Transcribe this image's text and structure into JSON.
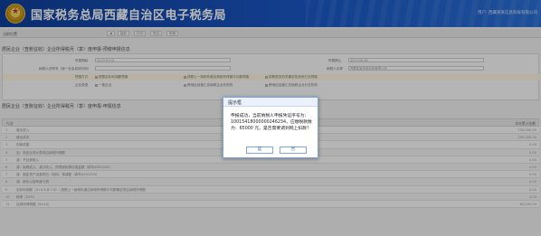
{
  "header": {
    "title": "国家税务总局西藏自治区电子税务局",
    "user_info": "用户: 西藏某某信息科技有限公司"
  },
  "toolbar": {
    "crumb": "当前位置",
    "buttons": [
      "◀",
      "保存",
      "打印",
      "导出",
      "申报"
    ]
  },
  "form_section": {
    "title": "居民企业（查账征收）企业所得税月（季）度申报-预缴申报信息",
    "rows": [
      {
        "label": "所属期起",
        "value": "2019-07-01",
        "label2": "所属期止",
        "value2": "2019-09-30"
      },
      {
        "label": "纳税人识别号（统一社会信用代码）",
        "value": "",
        "label2": "纳税人名称",
        "value2": "西藏某某信息科技有限公司"
      },
      {
        "label": "预缴方式",
        "value": "按照实际利润额预缴",
        "options": [
          "按照上一纳税年度应纳税所得额平均额预缴",
          "按照税务机关确定的其他方法预缴"
        ]
      },
      {
        "label": "企业类型",
        "value": "一般企业",
        "options": [
          "跨地区经营汇总纳税企业总机构",
          "跨地区经营汇总纳税企业分支机构"
        ]
      }
    ]
  },
  "table_section": {
    "title": "居民企业（查账征收）企业所得税月（季）度申报-申报信息",
    "col_index": "行次",
    "col_amount": "本年累计金额",
    "rows": [
      {
        "idx": "1",
        "label": "营业收入",
        "value": "200,000.00"
      },
      {
        "idx": "2",
        "label": "营业成本",
        "value": "200,000.00"
      },
      {
        "idx": "3",
        "label": "利润总额",
        "value": "0.00"
      },
      {
        "idx": "4",
        "label": "加：特定业务计算的应纳税所得额",
        "value": "0.00"
      },
      {
        "idx": "5",
        "label": "减：不征税收入",
        "value": "0.00"
      },
      {
        "idx": "6",
        "label": "减：免税收入、减计收入、所得减免等优惠金额（填写A201010）",
        "value": "0.00"
      },
      {
        "idx": "7",
        "label": "减：固定资产加速折旧（扣除）调减额（填写A201020）",
        "value": "0.00"
      },
      {
        "idx": "8",
        "label": "减：弥补以前年度亏损",
        "value": "0.00"
      },
      {
        "idx": "9",
        "label": "实际利润额（3+4-5-6-7-8）\\ 按照上一纳税年度应纳税所得额平均额确定的应纳税所得额",
        "value": "0.00"
      },
      {
        "idx": "10",
        "label": "税率（25%）",
        "value": "0.00"
      },
      {
        "idx": "11",
        "label": "应纳所得税额（9×10）",
        "value": "65,000.00"
      }
    ]
  },
  "dialog": {
    "title": "提示框",
    "message": "申报成功，当前纳税人申报凭证序号为：10015418000000246234，应缴税款数为：65000 元。是否需要调到网上扣款？",
    "confirm_label": "是",
    "cancel_label": "否"
  },
  "colors": {
    "header_bg": "#1b57c4",
    "dialog_border": "#7aa3d8",
    "button_text": "#2a5db0"
  }
}
